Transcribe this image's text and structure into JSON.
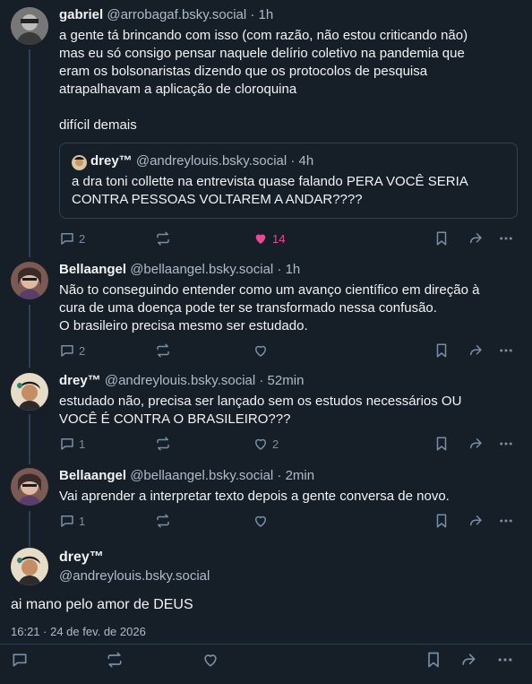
{
  "posts": [
    {
      "name": "gabriel",
      "handle": "@arrobagaf.bsky.social",
      "time": "· 1h",
      "text": "a gente tá brincando com isso (com razão, não estou criticando não)\nmas eu só consigo pensar naquele delírio coletivo na pandemia que\neram os bolsonaristas dizendo que os protocolos de pesquisa\natrapalhavam a aplicação de cloroquina\n\ndifícil demais",
      "quote": {
        "name": "drey™",
        "handle": "@andreylouis.bsky.social",
        "time": "· 4h",
        "text": "a dra toni collette na entrevista quase falando PERA VOCÊ SERIA\nCONTRA PESSOAS VOLTAREM A ANDAR????"
      },
      "replies": "2",
      "likes": "14",
      "liked": true
    },
    {
      "name": "Bellaangel",
      "handle": "@bellaangel.bsky.social",
      "time": "· 1h",
      "text": "Não to conseguindo entender como um avanço científico em direção à\ncura de uma doença pode ter se transformado nessa confusão.\nO brasileiro precisa mesmo ser estudado.",
      "replies": "2",
      "likes": ""
    },
    {
      "name": "drey™",
      "handle": "@andreylouis.bsky.social",
      "time": "· 52min",
      "text": "estudado não, precisa ser lançado sem os estudos necessários OU\nVOCÊ É CONTRA O BRASILEIRO???",
      "replies": "1",
      "likes": "2"
    },
    {
      "name": "Bellaangel",
      "handle": "@bellaangel.bsky.social",
      "time": "· 2min",
      "text": "Vai aprender a interpretar texto depois a gente conversa de novo.",
      "replies": "1",
      "likes": ""
    }
  ],
  "main_post": {
    "name": "drey™",
    "handle": "@andreylouis.bsky.social",
    "text": "ai mano pelo amor de DEUS",
    "timestamp": "16:21 · 24 de fev. de 2026"
  },
  "colors": {
    "accent_like": "#ec4899",
    "background": "#161e27",
    "muted": "#788ea5"
  },
  "icons": [
    "reply-icon",
    "repost-icon",
    "like-icon",
    "bookmark-icon",
    "share-icon",
    "more-icon"
  ]
}
